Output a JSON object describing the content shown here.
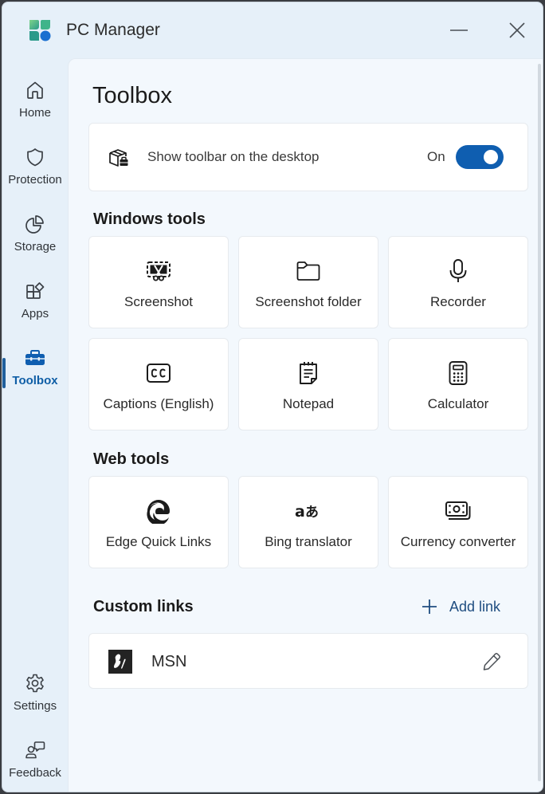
{
  "window": {
    "title": "PC Manager",
    "minimize_label": "Minimize",
    "close_label": "Close"
  },
  "sidebar": {
    "items": [
      {
        "id": "home",
        "label": "Home",
        "icon": "home-icon"
      },
      {
        "id": "protection",
        "label": "Protection",
        "icon": "shield-icon"
      },
      {
        "id": "storage",
        "label": "Storage",
        "icon": "pie-chart-icon"
      },
      {
        "id": "apps",
        "label": "Apps",
        "icon": "apps-icon"
      },
      {
        "id": "toolbox",
        "label": "Toolbox",
        "icon": "toolbox-icon",
        "active": true
      }
    ],
    "bottom_items": [
      {
        "id": "settings",
        "label": "Settings",
        "icon": "gear-icon"
      },
      {
        "id": "feedback",
        "label": "Feedback",
        "icon": "feedback-icon"
      }
    ]
  },
  "main": {
    "title": "Toolbox",
    "toolbar_toggle": {
      "label": "Show toolbar on the desktop",
      "state_label": "On",
      "on": true,
      "icon": "toolbar-box-icon"
    },
    "windows_tools": {
      "title": "Windows tools",
      "items": [
        {
          "label": "Screenshot",
          "icon": "screenshot-snip-icon"
        },
        {
          "label": "Screenshot folder",
          "icon": "folder-icon"
        },
        {
          "label": "Recorder",
          "icon": "microphone-icon"
        },
        {
          "label": "Captions (English)",
          "icon": "closed-captions-icon"
        },
        {
          "label": "Notepad",
          "icon": "notepad-icon"
        },
        {
          "label": "Calculator",
          "icon": "calculator-icon"
        }
      ]
    },
    "web_tools": {
      "title": "Web tools",
      "items": [
        {
          "label": "Edge Quick Links",
          "icon": "edge-icon"
        },
        {
          "label": "Bing translator",
          "icon": "translate-icon"
        },
        {
          "label": "Currency converter",
          "icon": "money-icon"
        }
      ]
    },
    "custom_links": {
      "title": "Custom links",
      "add_label": "Add link",
      "items": [
        {
          "label": "MSN",
          "icon": "msn-logo-icon"
        }
      ]
    }
  },
  "colors": {
    "accent": "#0f5eb0",
    "active_nav_text": "#0f5ea6",
    "window_bg": "#e6f0f9",
    "content_bg": "#f3f8fd"
  }
}
